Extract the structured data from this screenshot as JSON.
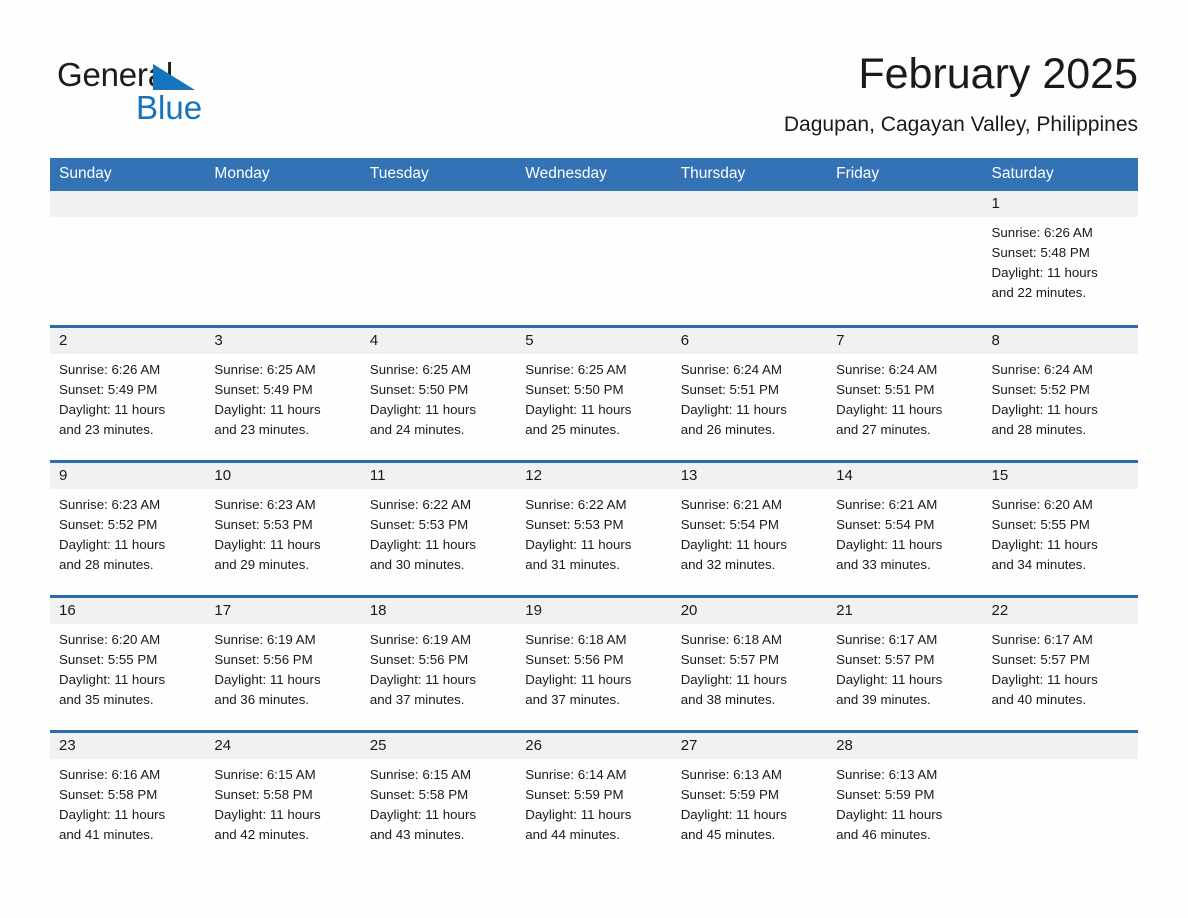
{
  "brand": {
    "word1": "General",
    "word2": "Blue",
    "triangle_color": "#1474bd"
  },
  "header": {
    "month_title": "February 2025",
    "location": "Dagupan, Cagayan Valley, Philippines"
  },
  "theme": {
    "header_blue": "#3272b5",
    "row_border_blue": "#2b6cad",
    "daynum_bg": "#f1f1f1"
  },
  "weekdays": [
    "Sunday",
    "Monday",
    "Tuesday",
    "Wednesday",
    "Thursday",
    "Friday",
    "Saturday"
  ],
  "weeks": [
    [
      {
        "day": "",
        "sunrise": "",
        "sunset": "",
        "daylight1": "",
        "daylight2": "",
        "shaded": true
      },
      {
        "day": "",
        "sunrise": "",
        "sunset": "",
        "daylight1": "",
        "daylight2": "",
        "shaded": true
      },
      {
        "day": "",
        "sunrise": "",
        "sunset": "",
        "daylight1": "",
        "daylight2": "",
        "shaded": true
      },
      {
        "day": "",
        "sunrise": "",
        "sunset": "",
        "daylight1": "",
        "daylight2": "",
        "shaded": true
      },
      {
        "day": "",
        "sunrise": "",
        "sunset": "",
        "daylight1": "",
        "daylight2": "",
        "shaded": true
      },
      {
        "day": "",
        "sunrise": "",
        "sunset": "",
        "daylight1": "",
        "daylight2": "",
        "shaded": true
      },
      {
        "day": "1",
        "sunrise": "Sunrise: 6:26 AM",
        "sunset": "Sunset: 5:48 PM",
        "daylight1": "Daylight: 11 hours",
        "daylight2": "and 22 minutes.",
        "shaded": true
      }
    ],
    [
      {
        "day": "2",
        "sunrise": "Sunrise: 6:26 AM",
        "sunset": "Sunset: 5:49 PM",
        "daylight1": "Daylight: 11 hours",
        "daylight2": "and 23 minutes.",
        "shaded": true
      },
      {
        "day": "3",
        "sunrise": "Sunrise: 6:25 AM",
        "sunset": "Sunset: 5:49 PM",
        "daylight1": "Daylight: 11 hours",
        "daylight2": "and 23 minutes.",
        "shaded": true
      },
      {
        "day": "4",
        "sunrise": "Sunrise: 6:25 AM",
        "sunset": "Sunset: 5:50 PM",
        "daylight1": "Daylight: 11 hours",
        "daylight2": "and 24 minutes.",
        "shaded": true
      },
      {
        "day": "5",
        "sunrise": "Sunrise: 6:25 AM",
        "sunset": "Sunset: 5:50 PM",
        "daylight1": "Daylight: 11 hours",
        "daylight2": "and 25 minutes.",
        "shaded": true
      },
      {
        "day": "6",
        "sunrise": "Sunrise: 6:24 AM",
        "sunset": "Sunset: 5:51 PM",
        "daylight1": "Daylight: 11 hours",
        "daylight2": "and 26 minutes.",
        "shaded": true
      },
      {
        "day": "7",
        "sunrise": "Sunrise: 6:24 AM",
        "sunset": "Sunset: 5:51 PM",
        "daylight1": "Daylight: 11 hours",
        "daylight2": "and 27 minutes.",
        "shaded": true
      },
      {
        "day": "8",
        "sunrise": "Sunrise: 6:24 AM",
        "sunset": "Sunset: 5:52 PM",
        "daylight1": "Daylight: 11 hours",
        "daylight2": "and 28 minutes.",
        "shaded": true
      }
    ],
    [
      {
        "day": "9",
        "sunrise": "Sunrise: 6:23 AM",
        "sunset": "Sunset: 5:52 PM",
        "daylight1": "Daylight: 11 hours",
        "daylight2": "and 28 minutes.",
        "shaded": true
      },
      {
        "day": "10",
        "sunrise": "Sunrise: 6:23 AM",
        "sunset": "Sunset: 5:53 PM",
        "daylight1": "Daylight: 11 hours",
        "daylight2": "and 29 minutes.",
        "shaded": true
      },
      {
        "day": "11",
        "sunrise": "Sunrise: 6:22 AM",
        "sunset": "Sunset: 5:53 PM",
        "daylight1": "Daylight: 11 hours",
        "daylight2": "and 30 minutes.",
        "shaded": true
      },
      {
        "day": "12",
        "sunrise": "Sunrise: 6:22 AM",
        "sunset": "Sunset: 5:53 PM",
        "daylight1": "Daylight: 11 hours",
        "daylight2": "and 31 minutes.",
        "shaded": true
      },
      {
        "day": "13",
        "sunrise": "Sunrise: 6:21 AM",
        "sunset": "Sunset: 5:54 PM",
        "daylight1": "Daylight: 11 hours",
        "daylight2": "and 32 minutes.",
        "shaded": true
      },
      {
        "day": "14",
        "sunrise": "Sunrise: 6:21 AM",
        "sunset": "Sunset: 5:54 PM",
        "daylight1": "Daylight: 11 hours",
        "daylight2": "and 33 minutes.",
        "shaded": true
      },
      {
        "day": "15",
        "sunrise": "Sunrise: 6:20 AM",
        "sunset": "Sunset: 5:55 PM",
        "daylight1": "Daylight: 11 hours",
        "daylight2": "and 34 minutes.",
        "shaded": true
      }
    ],
    [
      {
        "day": "16",
        "sunrise": "Sunrise: 6:20 AM",
        "sunset": "Sunset: 5:55 PM",
        "daylight1": "Daylight: 11 hours",
        "daylight2": "and 35 minutes.",
        "shaded": true
      },
      {
        "day": "17",
        "sunrise": "Sunrise: 6:19 AM",
        "sunset": "Sunset: 5:56 PM",
        "daylight1": "Daylight: 11 hours",
        "daylight2": "and 36 minutes.",
        "shaded": true
      },
      {
        "day": "18",
        "sunrise": "Sunrise: 6:19 AM",
        "sunset": "Sunset: 5:56 PM",
        "daylight1": "Daylight: 11 hours",
        "daylight2": "and 37 minutes.",
        "shaded": true
      },
      {
        "day": "19",
        "sunrise": "Sunrise: 6:18 AM",
        "sunset": "Sunset: 5:56 PM",
        "daylight1": "Daylight: 11 hours",
        "daylight2": "and 37 minutes.",
        "shaded": true
      },
      {
        "day": "20",
        "sunrise": "Sunrise: 6:18 AM",
        "sunset": "Sunset: 5:57 PM",
        "daylight1": "Daylight: 11 hours",
        "daylight2": "and 38 minutes.",
        "shaded": true
      },
      {
        "day": "21",
        "sunrise": "Sunrise: 6:17 AM",
        "sunset": "Sunset: 5:57 PM",
        "daylight1": "Daylight: 11 hours",
        "daylight2": "and 39 minutes.",
        "shaded": true
      },
      {
        "day": "22",
        "sunrise": "Sunrise: 6:17 AM",
        "sunset": "Sunset: 5:57 PM",
        "daylight1": "Daylight: 11 hours",
        "daylight2": "and 40 minutes.",
        "shaded": true
      }
    ],
    [
      {
        "day": "23",
        "sunrise": "Sunrise: 6:16 AM",
        "sunset": "Sunset: 5:58 PM",
        "daylight1": "Daylight: 11 hours",
        "daylight2": "and 41 minutes.",
        "shaded": true
      },
      {
        "day": "24",
        "sunrise": "Sunrise: 6:15 AM",
        "sunset": "Sunset: 5:58 PM",
        "daylight1": "Daylight: 11 hours",
        "daylight2": "and 42 minutes.",
        "shaded": true
      },
      {
        "day": "25",
        "sunrise": "Sunrise: 6:15 AM",
        "sunset": "Sunset: 5:58 PM",
        "daylight1": "Daylight: 11 hours",
        "daylight2": "and 43 minutes.",
        "shaded": true
      },
      {
        "day": "26",
        "sunrise": "Sunrise: 6:14 AM",
        "sunset": "Sunset: 5:59 PM",
        "daylight1": "Daylight: 11 hours",
        "daylight2": "and 44 minutes.",
        "shaded": true
      },
      {
        "day": "27",
        "sunrise": "Sunrise: 6:13 AM",
        "sunset": "Sunset: 5:59 PM",
        "daylight1": "Daylight: 11 hours",
        "daylight2": "and 45 minutes.",
        "shaded": true
      },
      {
        "day": "28",
        "sunrise": "Sunrise: 6:13 AM",
        "sunset": "Sunset: 5:59 PM",
        "daylight1": "Daylight: 11 hours",
        "daylight2": "and 46 minutes.",
        "shaded": true
      },
      {
        "day": "",
        "sunrise": "",
        "sunset": "",
        "daylight1": "",
        "daylight2": "",
        "shaded": true
      }
    ]
  ]
}
